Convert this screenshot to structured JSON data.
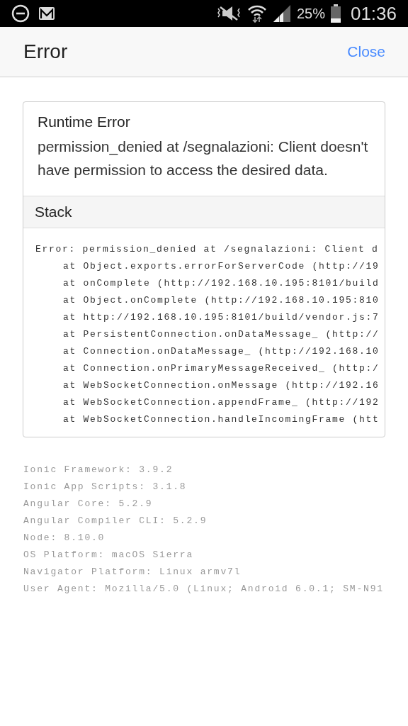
{
  "status_bar": {
    "battery": "25%",
    "time": "01:36"
  },
  "header": {
    "title": "Error",
    "close": "Close"
  },
  "error_card": {
    "title": "Runtime Error",
    "message": "permission_denied at /segnalazioni: Client doesn't have permission to access the desired data.",
    "stack_title": "Stack",
    "stack": [
      {
        "kind": "head",
        "text": "Error: permission_denied at /segnalazioni: Client d"
      },
      {
        "kind": "frame",
        "text": "at Object.exports.errorForServerCode (http://19"
      },
      {
        "kind": "frame",
        "text": "at onComplete (http://192.168.10.195:8101/build"
      },
      {
        "kind": "frame",
        "text": "at Object.onComplete (http://192.168.10.195:810"
      },
      {
        "kind": "frame",
        "text": "at http://192.168.10.195:8101/build/vendor.js:7"
      },
      {
        "kind": "frame",
        "text": "at PersistentConnection.onDataMessage_ (http://"
      },
      {
        "kind": "frame",
        "text": "at Connection.onDataMessage_ (http://192.168.10"
      },
      {
        "kind": "frame",
        "text": "at Connection.onPrimaryMessageReceived_ (http:/"
      },
      {
        "kind": "frame",
        "text": "at WebSocketConnection.onMessage (http://192.16"
      },
      {
        "kind": "frame",
        "text": "at WebSocketConnection.appendFrame_ (http://192"
      },
      {
        "kind": "frame",
        "text": "at WebSocketConnection.handleIncomingFrame (htt"
      }
    ]
  },
  "environment": [
    "Ionic Framework: 3.9.2",
    "Ionic App Scripts: 3.1.8",
    "Angular Core: 5.2.9",
    "Angular Compiler CLI: 5.2.9",
    "Node: 8.10.0",
    "OS Platform: macOS Sierra",
    "Navigator Platform: Linux armv7l",
    "User Agent: Mozilla/5.0 (Linux; Android 6.0.1; SM-N91"
  ]
}
